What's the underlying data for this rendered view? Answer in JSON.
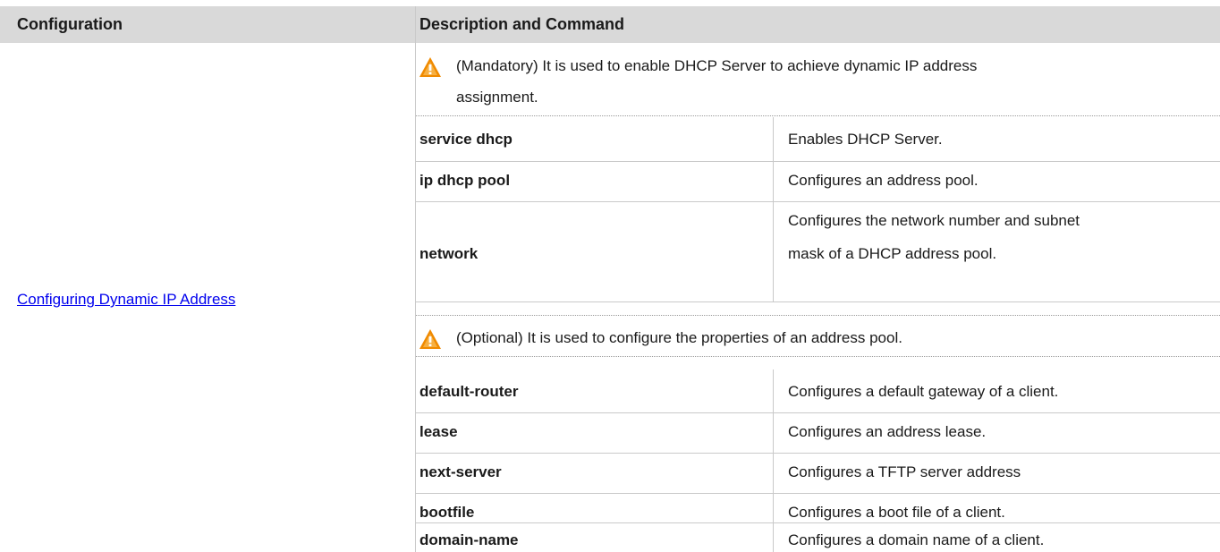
{
  "table": {
    "headers": {
      "configuration": "Configuration",
      "description": "Description and Command"
    },
    "configuration_link": "Configuring Dynamic IP Address",
    "mandatory_note": {
      "line1": "(Mandatory) It is used to enable DHCP Server to achieve dynamic IP address",
      "line2": "assignment."
    },
    "mandatory_rows": [
      {
        "command": "service dhcp",
        "description": "Enables DHCP Server."
      },
      {
        "command": "ip dhcp pool",
        "description": "Configures an address pool."
      },
      {
        "command": "network",
        "description_line1": "Configures the network number and subnet",
        "description_line2": "mask of a DHCP address pool."
      }
    ],
    "optional_note": "(Optional) It is used to configure the properties of an address pool.",
    "optional_rows": [
      {
        "command": "default-router",
        "description": "Configures a default gateway of a client."
      },
      {
        "command": "lease",
        "description": "Configures an address lease."
      },
      {
        "command": "next-server",
        "description": "Configures a TFTP server address"
      },
      {
        "command": "bootfile",
        "description": "Configures a boot file of a client."
      },
      {
        "command": "domain-name",
        "description": "Configures a domain name of a client."
      }
    ]
  },
  "icons": {
    "mandatory": "warning-icon",
    "optional": "warning-icon"
  },
  "colors": {
    "header_bg": "#d9d9d9",
    "link": "#0000ee",
    "warning": "#f08a00"
  }
}
